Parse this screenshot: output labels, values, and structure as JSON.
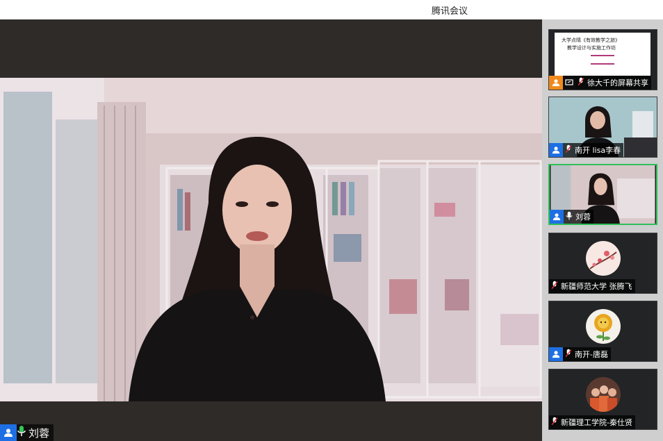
{
  "window": {
    "title": "腾讯会议"
  },
  "speaker": {
    "name": "刘蓉"
  },
  "participants": [
    {
      "name": "徐大千的屏幕共享",
      "type": "screen-share",
      "slide": {
        "line1": "大学点晴《有效教学之旅》",
        "line2": "教学设计与实施工作坊"
      }
    },
    {
      "name": "南开 lisa李春",
      "type": "video"
    },
    {
      "name": "刘蓉",
      "type": "video",
      "active": true
    },
    {
      "name": "新疆师范大学 张腾飞",
      "type": "avatar"
    },
    {
      "name": "南开-唐磊",
      "type": "avatar"
    },
    {
      "name": "新疆理工学院-秦仕贤",
      "type": "avatar"
    }
  ],
  "colors": {
    "badge_blue": "#1e6fe3",
    "badge_orange": "#f08a1c",
    "active_border": "#2fbf5a",
    "mic_green": "#35c55a",
    "mic_muted": "#e0313a"
  }
}
